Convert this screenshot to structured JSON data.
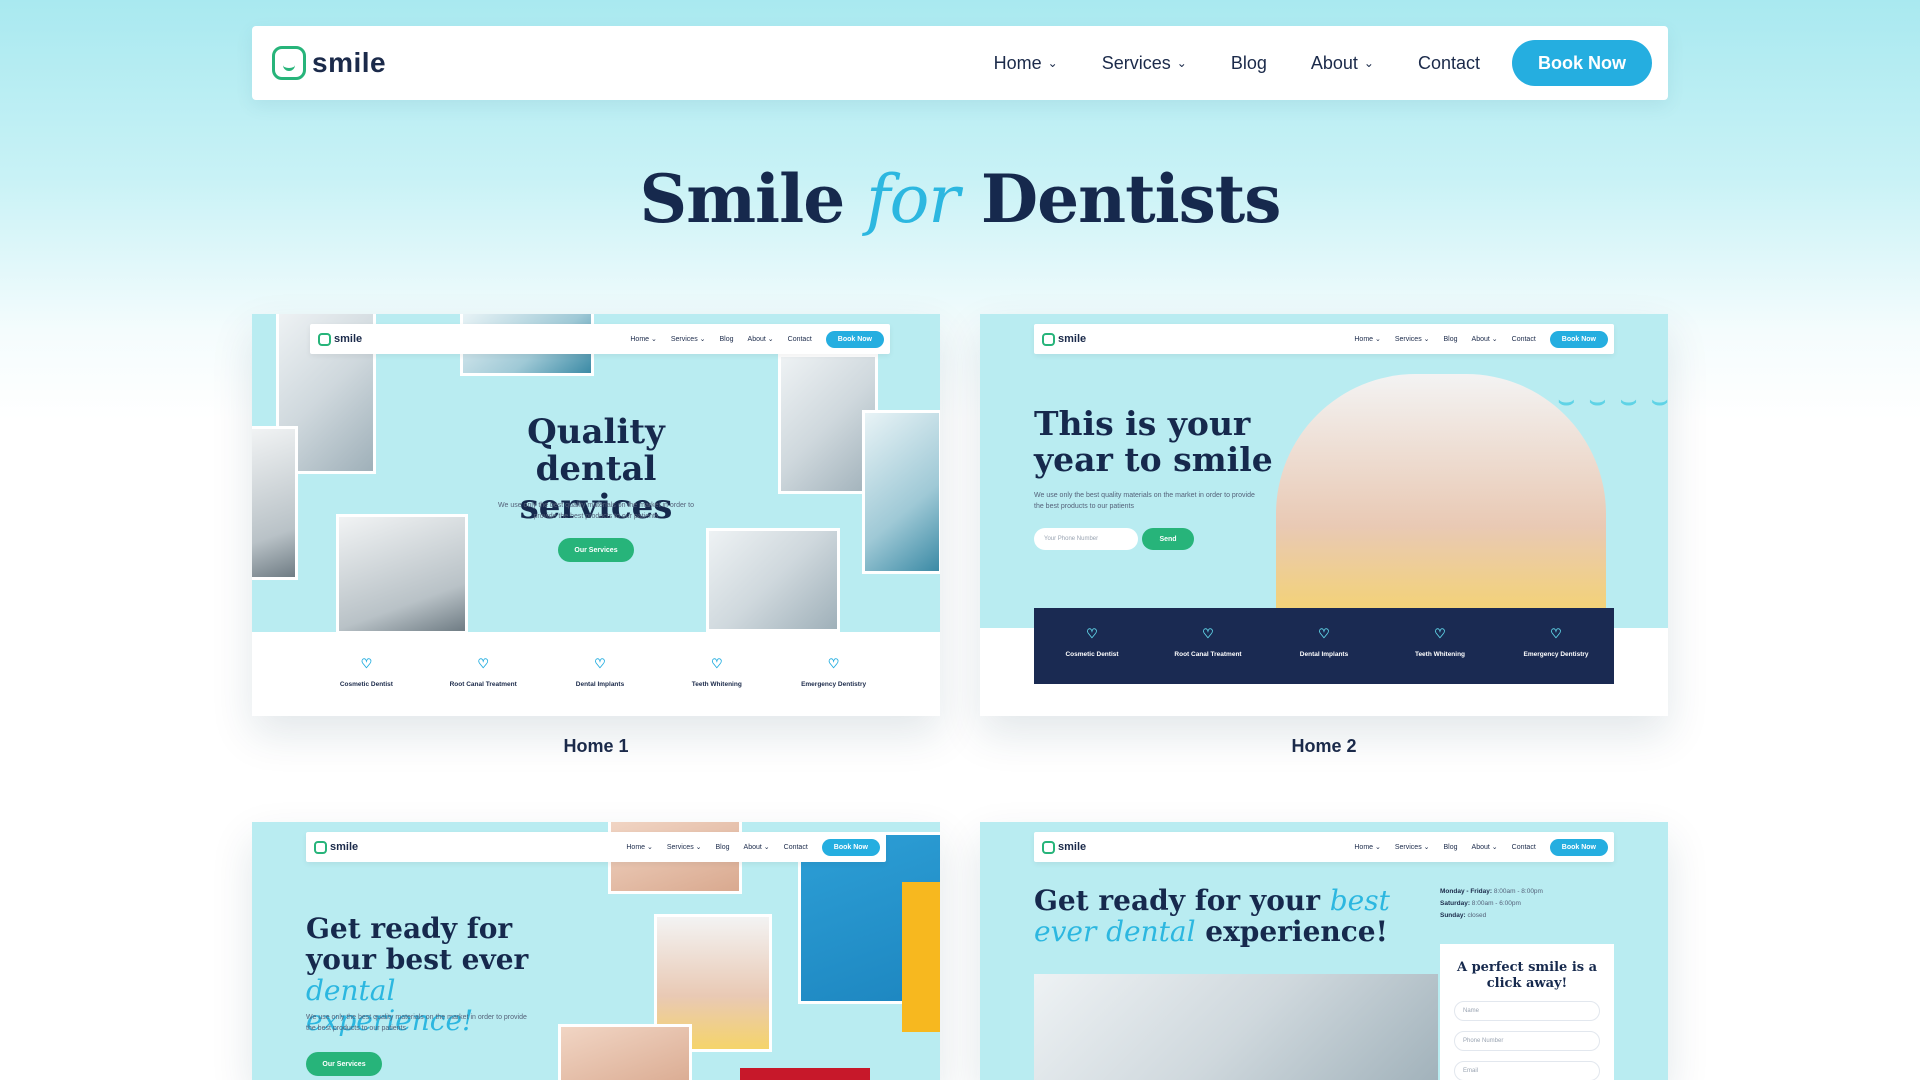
{
  "nav": {
    "logo": "smile",
    "items": [
      {
        "label": "Home",
        "dropdown": true
      },
      {
        "label": "Services",
        "dropdown": true
      },
      {
        "label": "Blog",
        "dropdown": false
      },
      {
        "label": "About",
        "dropdown": true
      },
      {
        "label": "Contact",
        "dropdown": false
      }
    ],
    "book_label": "Book Now"
  },
  "hero": {
    "title_pre": "Smile",
    "title_accent": "for",
    "title_post": "Dentists"
  },
  "mini_nav": {
    "logo": "smile",
    "items": [
      "Home ⌄",
      "Services ⌄",
      "Blog",
      "About ⌄",
      "Contact"
    ],
    "book_label": "Book Now"
  },
  "services": [
    "Cosmetic Dentist",
    "Root Canal Treatment",
    "Dental Implants",
    "Teeth Whitening",
    "Emergency Dentistry"
  ],
  "cards": {
    "home1": {
      "label": "Home 1",
      "heading": "Quality dental services",
      "text": "We use only the best quality materials on the market in order to provide the best products to our patients",
      "button": "Our Services"
    },
    "home2": {
      "label": "Home 2",
      "heading": "This is your year to smile",
      "text": "We use only the best quality materials on the market in order to provide the best products to our patients",
      "phone_placeholder": "Your Phone Number",
      "button": "Send"
    },
    "home3": {
      "heading_pre": "Get ready for your best ever",
      "heading_accent": "dental experience!",
      "text": "We use only the best quality materials on the market in order to provide the best products to our patients",
      "button": "Our Services"
    },
    "home4": {
      "heading_pre": "Get ready for your",
      "heading_accent1": "best ever",
      "heading_accent2": "dental",
      "heading_post": "experience!",
      "hours": [
        {
          "day": "Monday - Friday:",
          "time": "8:00am - 8:00pm"
        },
        {
          "day": "Saturday:",
          "time": "8:00am - 6:00pm"
        },
        {
          "day": "Sunday:",
          "time": "closed"
        }
      ],
      "form_title": "A perfect smile is a click away!",
      "fields": [
        "Name",
        "Phone Number",
        "Email"
      ]
    }
  },
  "colors": {
    "accent_blue": "#25aee0",
    "green": "#27b47a",
    "navy": "#16294d"
  }
}
